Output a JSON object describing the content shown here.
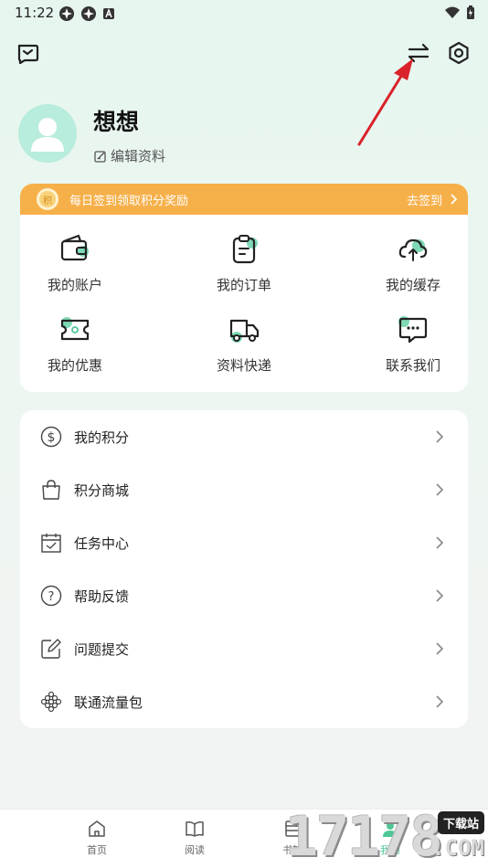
{
  "status_bar": {
    "time": "11:22"
  },
  "profile": {
    "name": "想想",
    "edit_label": "编辑资料"
  },
  "checkin": {
    "banner_text": "每日签到领取积分奖励",
    "action_label": "去签到",
    "coin_text": "积"
  },
  "quick_grid": [
    {
      "label": "我的账户",
      "icon": "wallet-icon"
    },
    {
      "label": "我的订单",
      "icon": "order-clipboard-icon"
    },
    {
      "label": "我的缓存",
      "icon": "cloud-sync-icon"
    },
    {
      "label": "我的优惠",
      "icon": "coupon-icon"
    },
    {
      "label": "资料快递",
      "icon": "delivery-truck-icon"
    },
    {
      "label": "联系我们",
      "icon": "chat-bubble-icon"
    }
  ],
  "menu": [
    {
      "label": "我的积分",
      "icon": "dollar-coin-icon"
    },
    {
      "label": "积分商城",
      "icon": "shopping-bag-icon"
    },
    {
      "label": "任务中心",
      "icon": "calendar-check-icon"
    },
    {
      "label": "帮助反馈",
      "icon": "question-circle-icon"
    },
    {
      "label": "问题提交",
      "icon": "edit-pencil-icon"
    },
    {
      "label": "联通流量包",
      "icon": "unicom-knot-icon"
    }
  ],
  "bottom_nav": [
    {
      "label": "首页",
      "icon": "home-icon",
      "active": false
    },
    {
      "label": "阅读",
      "icon": "book-icon",
      "active": false
    },
    {
      "label": "书架",
      "icon": "bookshelf-icon",
      "active": false
    },
    {
      "label": "我的",
      "icon": "profile-icon",
      "active": true
    }
  ],
  "watermark": {
    "digits": "17178",
    "badge": "下载站",
    "domain": ".COM"
  },
  "colors": {
    "accent_green": "#4fc796",
    "banner_orange": "#f6b04a",
    "arrow_red": "#d9222a"
  }
}
